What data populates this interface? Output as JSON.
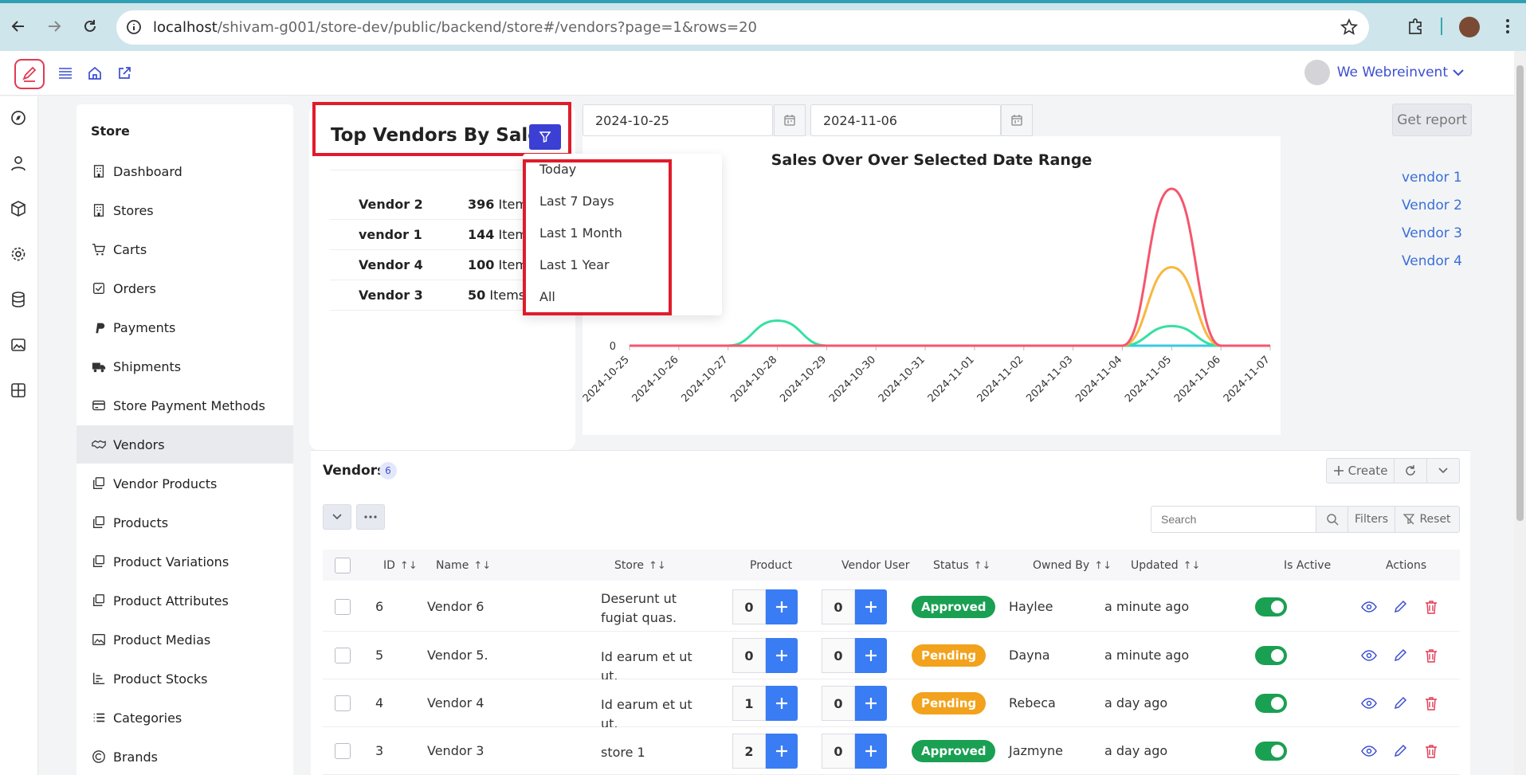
{
  "browser": {
    "url_host": "localhost",
    "url_path": "/shivam-g001/store-dev/public/backend/store#/vendors?page=1&rows=20"
  },
  "header": {
    "user_name": "We Webreinvent"
  },
  "sidebar": {
    "heading": "Store",
    "items": [
      {
        "label": "Dashboard",
        "icon": "building-icon"
      },
      {
        "label": "Stores",
        "icon": "building-icon"
      },
      {
        "label": "Carts",
        "icon": "cart-icon"
      },
      {
        "label": "Orders",
        "icon": "check-square-icon"
      },
      {
        "label": "Payments",
        "icon": "paypal-icon"
      },
      {
        "label": "Shipments",
        "icon": "truck-icon"
      },
      {
        "label": "Store Payment Methods",
        "icon": "credit-card-icon"
      },
      {
        "label": "Vendors",
        "icon": "handshake-icon"
      },
      {
        "label": "Vendor Products",
        "icon": "copy-icon"
      },
      {
        "label": "Products",
        "icon": "copy-icon"
      },
      {
        "label": "Product Variations",
        "icon": "copy-icon"
      },
      {
        "label": "Product Attributes",
        "icon": "copy-icon"
      },
      {
        "label": "Product Medias",
        "icon": "image-icon"
      },
      {
        "label": "Product Stocks",
        "icon": "bar-chart-icon"
      },
      {
        "label": "Categories",
        "icon": "list-icon"
      },
      {
        "label": "Brands",
        "icon": "copyright-icon"
      }
    ],
    "active_index": 7
  },
  "top_vendors": {
    "title": "Top Vendors By Sales",
    "rows": [
      {
        "name": "Vendor 2",
        "count": "396",
        "unit": "Items"
      },
      {
        "name": "vendor 1",
        "count": "144",
        "unit": "Items"
      },
      {
        "name": "Vendor 4",
        "count": "100",
        "unit": "Items"
      },
      {
        "name": "Vendor 3",
        "count": "50",
        "unit": "Items"
      }
    ]
  },
  "filter_menu": {
    "options": [
      "Today",
      "Last 7 Days",
      "Last 1 Month",
      "Last 1 Year",
      "All"
    ]
  },
  "report": {
    "start_date": "2024-10-25",
    "end_date": "2024-11-06",
    "get_report_label": "Get report"
  },
  "chart_data": {
    "type": "area",
    "title": "Sales Over Over Selected Date Range",
    "categories": [
      "2024-10-25",
      "2024-10-26",
      "2024-10-27",
      "2024-10-28",
      "2024-10-29",
      "2024-10-30",
      "2024-10-31",
      "2024-11-01",
      "2024-11-02",
      "2024-11-03",
      "2024-11-04",
      "2024-11-05",
      "2024-11-06",
      "2024-11-07"
    ],
    "series": [
      {
        "name": "vendor 1",
        "color": "#38c9e3",
        "values": [
          0,
          0,
          0,
          0,
          0,
          0,
          0,
          0,
          0,
          0,
          0,
          0,
          0,
          0
        ]
      },
      {
        "name": "Vendor 2",
        "color": "#f5566e",
        "values": [
          0,
          0,
          0,
          0,
          0,
          0,
          0,
          0,
          0,
          0,
          0,
          200,
          0,
          0
        ]
      },
      {
        "name": "Vendor 3",
        "color": "#36e0a3",
        "values": [
          0,
          0,
          0,
          32,
          0,
          0,
          0,
          0,
          0,
          0,
          0,
          25,
          0,
          0
        ]
      },
      {
        "name": "Vendor 4",
        "color": "#f9b740",
        "values": [
          0,
          0,
          0,
          0,
          0,
          0,
          0,
          0,
          0,
          0,
          0,
          100,
          0,
          0
        ]
      }
    ],
    "y_tick_labels": [
      "0"
    ],
    "ylim": [
      0,
      200
    ]
  },
  "vendors_table": {
    "title": "Vendors",
    "count": "6",
    "create_label": "Create",
    "search_placeholder": "Search",
    "filters_label": "Filters",
    "reset_label": "Reset",
    "columns": [
      "ID",
      "Name",
      "Store",
      "Product",
      "Vendor User",
      "Status",
      "Owned By",
      "Updated",
      "Is Active",
      "Actions"
    ],
    "rows": [
      {
        "id": "6",
        "name": "Vendor 6",
        "store": "Deserunt ut fugiat quas.",
        "product": "0",
        "vendor_user": "0",
        "status": "Approved",
        "owned_by": "Haylee",
        "updated": "a minute ago"
      },
      {
        "id": "5",
        "name": "Vendor 5.",
        "store": "Id earum et ut ut.",
        "product": "0",
        "vendor_user": "0",
        "status": "Pending",
        "owned_by": "Dayna",
        "updated": "a minute ago"
      },
      {
        "id": "4",
        "name": "Vendor 4",
        "store": "Id earum et ut ut.",
        "product": "1",
        "vendor_user": "0",
        "status": "Pending",
        "owned_by": "Rebeca",
        "updated": "a day ago"
      },
      {
        "id": "3",
        "name": "Vendor 3",
        "store": "store 1",
        "product": "2",
        "vendor_user": "0",
        "status": "Approved",
        "owned_by": "Jazmyne",
        "updated": "a day ago"
      }
    ]
  },
  "colors": {
    "accent": "#3b4fd0",
    "approved": "#1aa052",
    "pending": "#f2a21c",
    "highlight_box": "#e01b2b"
  }
}
